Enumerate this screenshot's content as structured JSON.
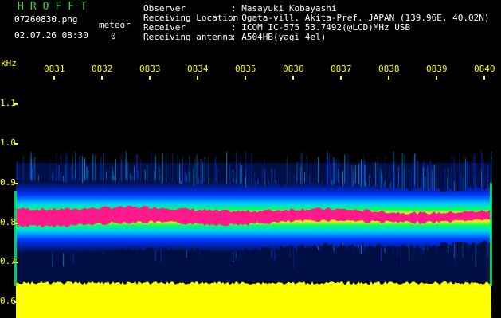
{
  "header": {
    "logo": "HROFFT",
    "filename": "07260830.png",
    "datetime": "02.07.26 08:30",
    "meteor_label": "meteor",
    "meteor_count": "0"
  },
  "info": {
    "observer_label": "Observer",
    "observer_value": ": Masayuki Kobayashi",
    "location_label": "Receiving Location",
    "location_value": ": Ogata-vill. Akita-Pref. JAPAN (139.96E, 40.02N)",
    "receiver_label": "Receiver",
    "receiver_value": ": ICOM IC-575 53.7492(@LCD)MHz USB",
    "antenna_label": "Receiving antenna",
    "antenna_value": ": A504HB(yagi 4el)"
  },
  "axes": {
    "unit": "kHz",
    "y_ticks": [
      "1.1",
      "1.0",
      "0.9",
      "0.8",
      "0.7",
      "0.6"
    ],
    "x_ticks": [
      "0831",
      "0832",
      "0833",
      "0834",
      "0835",
      "0836",
      "0837",
      "0838",
      "0839",
      "0840"
    ]
  },
  "colors": {
    "text_yellow": "#ffff00",
    "logo_green": "#3fd23f",
    "signal_core": "#ff1a8c",
    "signal_mid": "#00ff66",
    "signal_outer": "#0055ff",
    "noise_floor": "#ffff00"
  }
}
